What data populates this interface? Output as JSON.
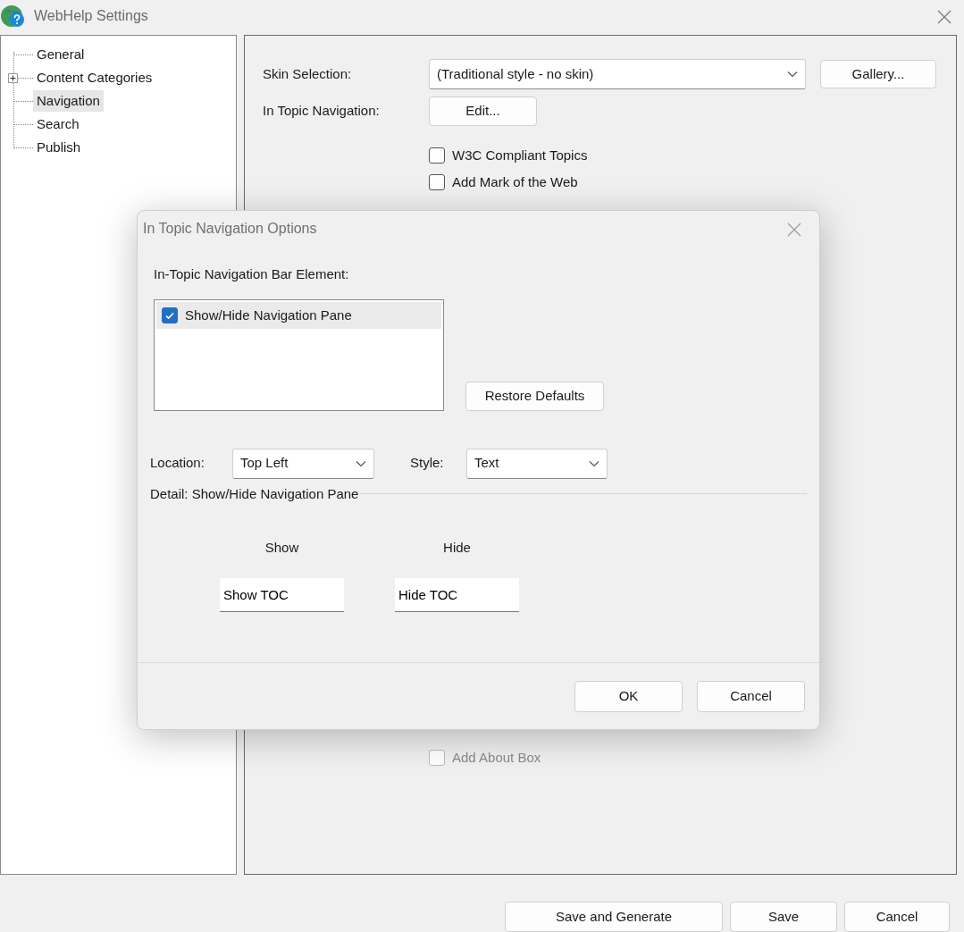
{
  "window": {
    "title": "WebHelp Settings"
  },
  "tree": [
    {
      "label": "General",
      "selected": false,
      "expander": false
    },
    {
      "label": "Content Categories",
      "selected": false,
      "expander": true
    },
    {
      "label": "Navigation",
      "selected": true,
      "expander": false
    },
    {
      "label": "Search",
      "selected": false,
      "expander": false
    },
    {
      "label": "Publish",
      "selected": false,
      "expander": false
    }
  ],
  "settings": {
    "skin_label": "Skin Selection:",
    "skin_value": "(Traditional style - no skin)",
    "gallery_button": "Gallery...",
    "in_topic_label": "In Topic Navigation:",
    "edit_button": "Edit...",
    "options": [
      {
        "label": "W3C Compliant Topics",
        "checked": false,
        "disabled": false
      },
      {
        "label": "Add Mark of the Web",
        "checked": false,
        "disabled": false
      }
    ],
    "lower_options": [
      {
        "label": "Add About Box",
        "checked": false,
        "disabled": true
      }
    ]
  },
  "buttons": [
    "Save and Generate",
    "Save",
    "Cancel"
  ],
  "dialog": {
    "title": "In Topic Navigation Options",
    "list_label": "In-Topic Navigation Bar Element:",
    "list_items": [
      {
        "label": "Show/Hide Navigation Pane",
        "checked": true,
        "selected": true
      }
    ],
    "restore_button": "Restore Defaults",
    "location": {
      "label": "Location:",
      "value": "Top Left"
    },
    "style": {
      "label": "Style:",
      "value": "Text"
    },
    "detail_label": "Detail: Show/Hide Navigation Pane",
    "columns": [
      {
        "heading": "Show",
        "value": "Show TOC"
      },
      {
        "heading": "Hide",
        "value": "Hide TOC"
      }
    ],
    "buttons": [
      "OK",
      "Cancel"
    ]
  }
}
